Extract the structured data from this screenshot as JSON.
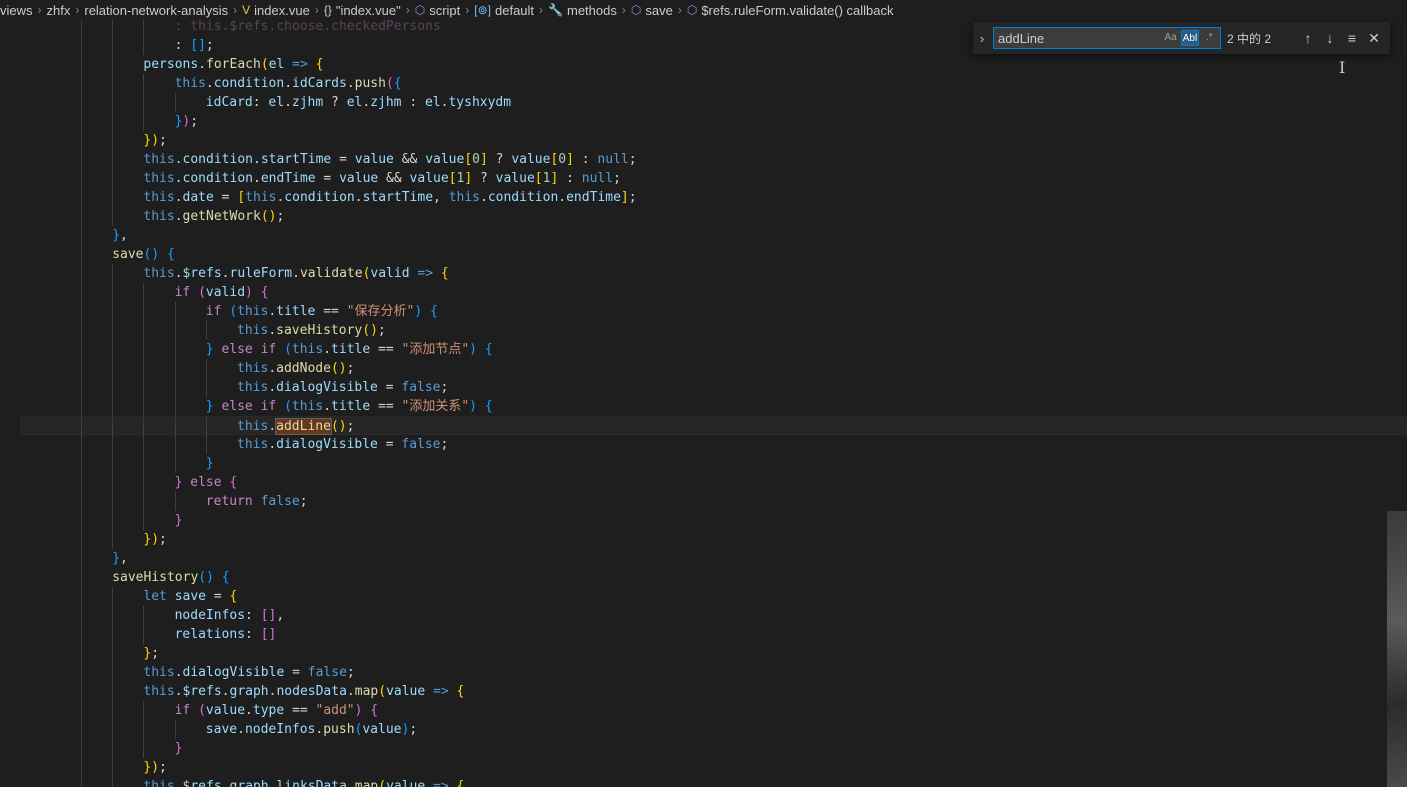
{
  "breadcrumb": [
    {
      "label": "views",
      "icon": ""
    },
    {
      "label": "zhfx",
      "icon": ""
    },
    {
      "label": "relation-network-analysis",
      "icon": ""
    },
    {
      "label": "index.vue",
      "icon": "vue-icon"
    },
    {
      "label": "\"index.vue\"",
      "icon": "braces-icon"
    },
    {
      "label": "script",
      "icon": "cube-icon"
    },
    {
      "label": "default",
      "icon": "variable-icon"
    },
    {
      "label": "methods",
      "icon": "wrench-icon"
    },
    {
      "label": "save",
      "icon": "cube-icon"
    },
    {
      "label": "$refs.ruleForm.validate() callback",
      "icon": "cube-icon"
    }
  ],
  "find": {
    "value": "addLine",
    "opt_case": "Aa",
    "opt_word": "Abl",
    "opt_regex": ".*",
    "count": "2 中的 2",
    "prev": "↑",
    "next": "↓",
    "selection": "≡",
    "close": "✕",
    "toggle": "›"
  },
  "colors": {
    "background": "#1e1e1e",
    "keyword": "#569cd6",
    "control": "#c586c0",
    "property": "#9cdcfe",
    "function": "#dcdcaa",
    "string": "#ce9178",
    "number": "#b5cea8",
    "find_border": "#007fd4"
  },
  "code": {
    "lines": [
      [
        [
          "cm",
          ": this.$refs.choose.checkedPersons"
        ]
      ],
      [
        [
          "t",
          ": "
        ],
        [
          "p3",
          "[]"
        ],
        [
          "t",
          ";"
        ]
      ],
      [
        [
          "pr",
          "persons"
        ],
        [
          "t",
          "."
        ],
        [
          "f",
          "forEach"
        ],
        [
          "p1",
          "("
        ],
        [
          "pr",
          "el"
        ],
        [
          "k",
          " =>"
        ],
        [
          "t",
          " "
        ],
        [
          "p1",
          "{"
        ]
      ],
      [
        [
          "k",
          "this"
        ],
        [
          "t",
          "."
        ],
        [
          "pr",
          "condition"
        ],
        [
          "t",
          "."
        ],
        [
          "pr",
          "idCards"
        ],
        [
          "t",
          "."
        ],
        [
          "f",
          "push"
        ],
        [
          "p2",
          "("
        ],
        [
          "p3",
          "{"
        ]
      ],
      [
        [
          "pr",
          "idCard"
        ],
        [
          "t",
          ": "
        ],
        [
          "pr",
          "el"
        ],
        [
          "t",
          "."
        ],
        [
          "pr",
          "zjhm"
        ],
        [
          "t",
          " ? "
        ],
        [
          "pr",
          "el"
        ],
        [
          "t",
          "."
        ],
        [
          "pr",
          "zjhm"
        ],
        [
          "t",
          " : "
        ],
        [
          "pr",
          "el"
        ],
        [
          "t",
          "."
        ],
        [
          "pr",
          "tyshxydm"
        ]
      ],
      [
        [
          "p3",
          "}"
        ],
        [
          "p2",
          ")"
        ],
        [
          "t",
          ";"
        ]
      ],
      [
        [
          "p1",
          "}"
        ],
        [
          "p1",
          ")"
        ],
        [
          "t",
          ";"
        ]
      ],
      [
        [
          "k",
          "this"
        ],
        [
          "t",
          "."
        ],
        [
          "pr",
          "condition"
        ],
        [
          "t",
          "."
        ],
        [
          "pr",
          "startTime"
        ],
        [
          "t",
          " = "
        ],
        [
          "pr",
          "value"
        ],
        [
          "t",
          " && "
        ],
        [
          "pr",
          "value"
        ],
        [
          "p1",
          "["
        ],
        [
          "n",
          "0"
        ],
        [
          "p1",
          "]"
        ],
        [
          "t",
          " ? "
        ],
        [
          "pr",
          "value"
        ],
        [
          "p1",
          "["
        ],
        [
          "n",
          "0"
        ],
        [
          "p1",
          "]"
        ],
        [
          "t",
          " : "
        ],
        [
          "k",
          "null"
        ],
        [
          "t",
          ";"
        ]
      ],
      [
        [
          "k",
          "this"
        ],
        [
          "t",
          "."
        ],
        [
          "pr",
          "condition"
        ],
        [
          "t",
          "."
        ],
        [
          "pr",
          "endTime"
        ],
        [
          "t",
          " = "
        ],
        [
          "pr",
          "value"
        ],
        [
          "t",
          " && "
        ],
        [
          "pr",
          "value"
        ],
        [
          "p1",
          "["
        ],
        [
          "n",
          "1"
        ],
        [
          "p1",
          "]"
        ],
        [
          "t",
          " ? "
        ],
        [
          "pr",
          "value"
        ],
        [
          "p1",
          "["
        ],
        [
          "n",
          "1"
        ],
        [
          "p1",
          "]"
        ],
        [
          "t",
          " : "
        ],
        [
          "k",
          "null"
        ],
        [
          "t",
          ";"
        ]
      ],
      [
        [
          "k",
          "this"
        ],
        [
          "t",
          "."
        ],
        [
          "pr",
          "date"
        ],
        [
          "t",
          " = "
        ],
        [
          "p1",
          "["
        ],
        [
          "k",
          "this"
        ],
        [
          "t",
          "."
        ],
        [
          "pr",
          "condition"
        ],
        [
          "t",
          "."
        ],
        [
          "pr",
          "startTime"
        ],
        [
          "t",
          ", "
        ],
        [
          "k",
          "this"
        ],
        [
          "t",
          "."
        ],
        [
          "pr",
          "condition"
        ],
        [
          "t",
          "."
        ],
        [
          "pr",
          "endTime"
        ],
        [
          "p1",
          "]"
        ],
        [
          "t",
          ";"
        ]
      ],
      [
        [
          "k",
          "this"
        ],
        [
          "t",
          "."
        ],
        [
          "f",
          "getNetWork"
        ],
        [
          "p1",
          "("
        ],
        [
          "p1",
          ")"
        ],
        [
          "t",
          ";"
        ]
      ],
      [
        [
          "p3",
          "}"
        ],
        [
          "t",
          ","
        ]
      ],
      [
        [
          "f",
          "save"
        ],
        [
          "p3",
          "("
        ],
        [
          "p3",
          ")"
        ],
        [
          "t",
          " "
        ],
        [
          "p3",
          "{"
        ]
      ],
      [
        [
          "k",
          "this"
        ],
        [
          "t",
          "."
        ],
        [
          "pr",
          "$refs"
        ],
        [
          "t",
          "."
        ],
        [
          "pr",
          "ruleForm"
        ],
        [
          "t",
          "."
        ],
        [
          "f",
          "validate"
        ],
        [
          "p1",
          "("
        ],
        [
          "pr",
          "valid"
        ],
        [
          "k",
          " =>"
        ],
        [
          "t",
          " "
        ],
        [
          "p1",
          "{"
        ]
      ],
      [
        [
          "c",
          "if"
        ],
        [
          "t",
          " "
        ],
        [
          "p2",
          "("
        ],
        [
          "pr",
          "valid"
        ],
        [
          "p2",
          ")"
        ],
        [
          "t",
          " "
        ],
        [
          "p2",
          "{"
        ]
      ],
      [
        [
          "c",
          "if"
        ],
        [
          "t",
          " "
        ],
        [
          "p3",
          "("
        ],
        [
          "k",
          "this"
        ],
        [
          "t",
          "."
        ],
        [
          "pr",
          "title"
        ],
        [
          "t",
          " == "
        ],
        [
          "s",
          "\"保存分析\""
        ],
        [
          "p3",
          ")"
        ],
        [
          "t",
          " "
        ],
        [
          "p3",
          "{"
        ]
      ],
      [
        [
          "k",
          "this"
        ],
        [
          "t",
          "."
        ],
        [
          "f",
          "saveHistory"
        ],
        [
          "p1",
          "("
        ],
        [
          "p1",
          ")"
        ],
        [
          "t",
          ";"
        ]
      ],
      [
        [
          "p3",
          "}"
        ],
        [
          "t",
          " "
        ],
        [
          "c",
          "else if"
        ],
        [
          "t",
          " "
        ],
        [
          "p3",
          "("
        ],
        [
          "k",
          "this"
        ],
        [
          "t",
          "."
        ],
        [
          "pr",
          "title"
        ],
        [
          "t",
          " == "
        ],
        [
          "s",
          "\"添加节点\""
        ],
        [
          "p3",
          ")"
        ],
        [
          "t",
          " "
        ],
        [
          "p3",
          "{"
        ]
      ],
      [
        [
          "k",
          "this"
        ],
        [
          "t",
          "."
        ],
        [
          "f",
          "addNode"
        ],
        [
          "p1",
          "("
        ],
        [
          "p1",
          ")"
        ],
        [
          "t",
          ";"
        ]
      ],
      [
        [
          "k",
          "this"
        ],
        [
          "t",
          "."
        ],
        [
          "pr",
          "dialogVisible"
        ],
        [
          "t",
          " = "
        ],
        [
          "k",
          "false"
        ],
        [
          "t",
          ";"
        ]
      ],
      [
        [
          "p3",
          "}"
        ],
        [
          "t",
          " "
        ],
        [
          "c",
          "else if"
        ],
        [
          "t",
          " "
        ],
        [
          "p3",
          "("
        ],
        [
          "k",
          "this"
        ],
        [
          "t",
          "."
        ],
        [
          "pr",
          "title"
        ],
        [
          "t",
          " == "
        ],
        [
          "s",
          "\"添加关系\""
        ],
        [
          "p3",
          ")"
        ],
        [
          "t",
          " "
        ],
        [
          "p3",
          "{"
        ]
      ],
      [
        [
          "k",
          "this"
        ],
        [
          "t",
          "."
        ],
        [
          "fm",
          "addLine"
        ],
        [
          "p1",
          "("
        ],
        [
          "p1",
          ")"
        ],
        [
          "t",
          ";"
        ]
      ],
      [
        [
          "k",
          "this"
        ],
        [
          "t",
          "."
        ],
        [
          "pr",
          "dialogVisible"
        ],
        [
          "t",
          " = "
        ],
        [
          "k",
          "false"
        ],
        [
          "t",
          ";"
        ]
      ],
      [
        [
          "p3",
          "}"
        ]
      ],
      [
        [
          "p2",
          "}"
        ],
        [
          "t",
          " "
        ],
        [
          "c",
          "else"
        ],
        [
          "t",
          " "
        ],
        [
          "p2",
          "{"
        ]
      ],
      [
        [
          "c",
          "return"
        ],
        [
          "t",
          " "
        ],
        [
          "k",
          "false"
        ],
        [
          "t",
          ";"
        ]
      ],
      [
        [
          "p2",
          "}"
        ]
      ],
      [
        [
          "p1",
          "}"
        ],
        [
          "p1",
          ")"
        ],
        [
          "t",
          ";"
        ]
      ],
      [
        [
          "p3",
          "}"
        ],
        [
          "t",
          ","
        ]
      ],
      [
        [
          "f",
          "saveHistory"
        ],
        [
          "p3",
          "("
        ],
        [
          "p3",
          ")"
        ],
        [
          "t",
          " "
        ],
        [
          "p3",
          "{"
        ]
      ],
      [
        [
          "k",
          "let"
        ],
        [
          "t",
          " "
        ],
        [
          "pr",
          "save"
        ],
        [
          "t",
          " = "
        ],
        [
          "p1",
          "{"
        ]
      ],
      [
        [
          "pr",
          "nodeInfos"
        ],
        [
          "t",
          ": "
        ],
        [
          "p2",
          "[]"
        ],
        [
          "t",
          ","
        ]
      ],
      [
        [
          "pr",
          "relations"
        ],
        [
          "t",
          ": "
        ],
        [
          "p2",
          "[]"
        ]
      ],
      [
        [
          "p1",
          "}"
        ],
        [
          "t",
          ";"
        ]
      ],
      [
        [
          "k",
          "this"
        ],
        [
          "t",
          "."
        ],
        [
          "pr",
          "dialogVisible"
        ],
        [
          "t",
          " = "
        ],
        [
          "k",
          "false"
        ],
        [
          "t",
          ";"
        ]
      ],
      [
        [
          "k",
          "this"
        ],
        [
          "t",
          "."
        ],
        [
          "pr",
          "$refs"
        ],
        [
          "t",
          "."
        ],
        [
          "pr",
          "graph"
        ],
        [
          "t",
          "."
        ],
        [
          "pr",
          "nodesData"
        ],
        [
          "t",
          "."
        ],
        [
          "f",
          "map"
        ],
        [
          "p1",
          "("
        ],
        [
          "pr",
          "value"
        ],
        [
          "k",
          " =>"
        ],
        [
          "t",
          " "
        ],
        [
          "p1",
          "{"
        ]
      ],
      [
        [
          "c",
          "if"
        ],
        [
          "t",
          " "
        ],
        [
          "p2",
          "("
        ],
        [
          "pr",
          "value"
        ],
        [
          "t",
          "."
        ],
        [
          "pr",
          "type"
        ],
        [
          "t",
          " == "
        ],
        [
          "s",
          "\"add\""
        ],
        [
          "p2",
          ")"
        ],
        [
          "t",
          " "
        ],
        [
          "p2",
          "{"
        ]
      ],
      [
        [
          "pr",
          "save"
        ],
        [
          "t",
          "."
        ],
        [
          "pr",
          "nodeInfos"
        ],
        [
          "t",
          "."
        ],
        [
          "f",
          "push"
        ],
        [
          "p3",
          "("
        ],
        [
          "pr",
          "value"
        ],
        [
          "p3",
          ")"
        ],
        [
          "t",
          ";"
        ]
      ],
      [
        [
          "p2",
          "}"
        ]
      ],
      [
        [
          "p1",
          "}"
        ],
        [
          "p1",
          ")"
        ],
        [
          "t",
          ";"
        ]
      ],
      [
        [
          "k",
          "this"
        ],
        [
          "t",
          "."
        ],
        [
          "pr",
          "$refs"
        ],
        [
          "t",
          "."
        ],
        [
          "pr",
          "graph"
        ],
        [
          "t",
          "."
        ],
        [
          "pr",
          "linksData"
        ],
        [
          "t",
          "."
        ],
        [
          "f",
          "map"
        ],
        [
          "p1",
          "("
        ],
        [
          "pr",
          "value"
        ],
        [
          "k",
          " =>"
        ],
        [
          "t",
          " "
        ],
        [
          "p1",
          "{"
        ]
      ]
    ]
  }
}
